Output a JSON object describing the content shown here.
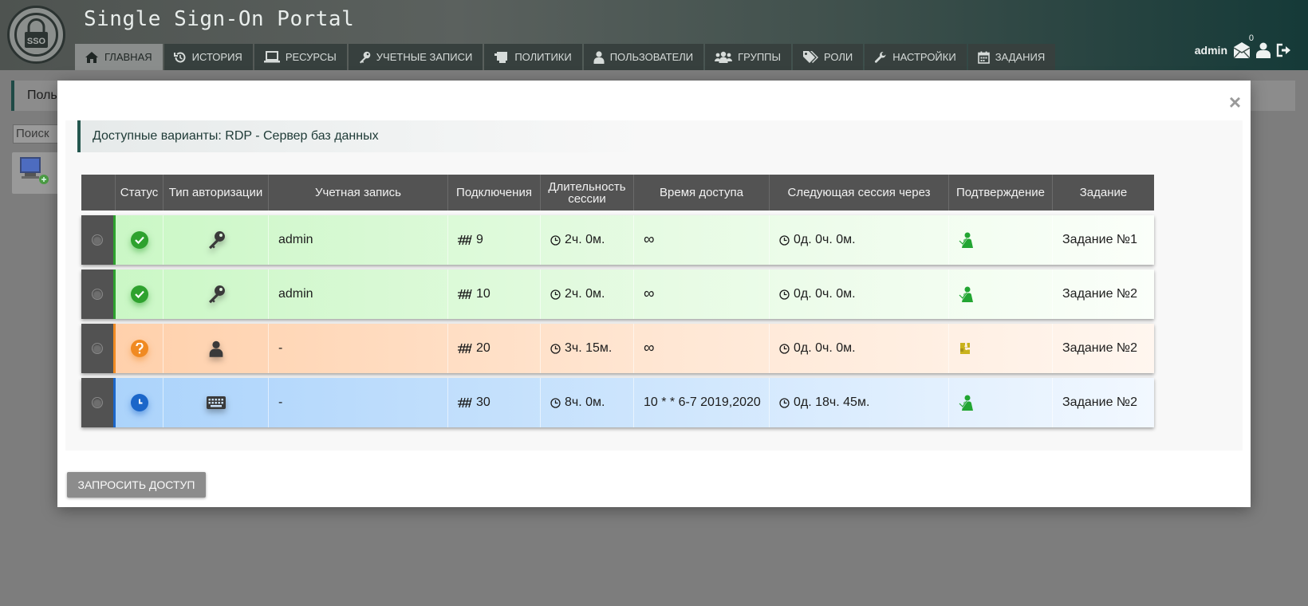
{
  "app": {
    "title": "Single Sign-On Portal",
    "logo_text": "SSO"
  },
  "nav": {
    "tabs": [
      {
        "label": "Главная",
        "icon": "home-icon",
        "active": true
      },
      {
        "label": "История",
        "icon": "history-icon"
      },
      {
        "label": "Ресурсы",
        "icon": "laptop-icon"
      },
      {
        "label": "Учетные записи",
        "icon": "key-icon"
      },
      {
        "label": "Политики",
        "icon": "scroll-icon"
      },
      {
        "label": "Пользователи",
        "icon": "user-icon"
      },
      {
        "label": "Группы",
        "icon": "users-icon"
      },
      {
        "label": "Роли",
        "icon": "tags-icon"
      },
      {
        "label": "Настройки",
        "icon": "wrench-icon"
      },
      {
        "label": "Задания",
        "icon": "calendar-icon"
      }
    ]
  },
  "user": {
    "name": "admin",
    "mail_count": "0"
  },
  "background": {
    "title_partial": "Поль",
    "search_placeholder": "Поиск"
  },
  "modal": {
    "close_label": "×",
    "heading": "Доступные варианты: RDP - Сервер баз данных",
    "columns": [
      "",
      "Статус",
      "Тип авторизации",
      "Учетная запись",
      "Подключения",
      "Длительность сессии",
      "Время доступа",
      "Следующая сессия через",
      "Подтверждение",
      "Задание"
    ],
    "rows": [
      {
        "theme": "green",
        "status_icon": "check-circle-icon",
        "auth_icon": "key-icon",
        "account": "admin",
        "connections": "9",
        "duration": "2ч. 0м.",
        "access_time": "∞",
        "next_session": "0д. 0ч. 0м.",
        "approval_icon": "approved-user-icon",
        "task": "Задание №1"
      },
      {
        "theme": "green",
        "status_icon": "check-circle-icon",
        "auth_icon": "key-icon",
        "account": "admin",
        "connections": "10",
        "duration": "2ч. 0м.",
        "access_time": "∞",
        "next_session": "0д. 0ч. 0м.",
        "approval_icon": "approved-user-icon",
        "task": "Задание №2"
      },
      {
        "theme": "orange",
        "status_icon": "question-circle-icon",
        "auth_icon": "user-icon",
        "account": "-",
        "connections": "20",
        "duration": "3ч. 15м.",
        "access_time": "∞",
        "next_session": "0д. 0ч. 0м.",
        "approval_icon": "puzzle-icon",
        "task": "Задание №2"
      },
      {
        "theme": "blue",
        "status_icon": "clock-circle-icon",
        "auth_icon": "keyboard-icon",
        "account": "-",
        "connections": "30",
        "duration": "8ч. 0м.",
        "access_time": "10 * * 6-7 2019,2020",
        "next_session": "0д. 18ч. 45м.",
        "approval_icon": "approved-user-icon",
        "task": "Задание №2"
      }
    ],
    "request_button": "Запросить доступ"
  },
  "colors": {
    "green": "#2ea22e",
    "orange": "#f08a22",
    "blue": "#1b66c9",
    "header_dark": "#153a38"
  }
}
